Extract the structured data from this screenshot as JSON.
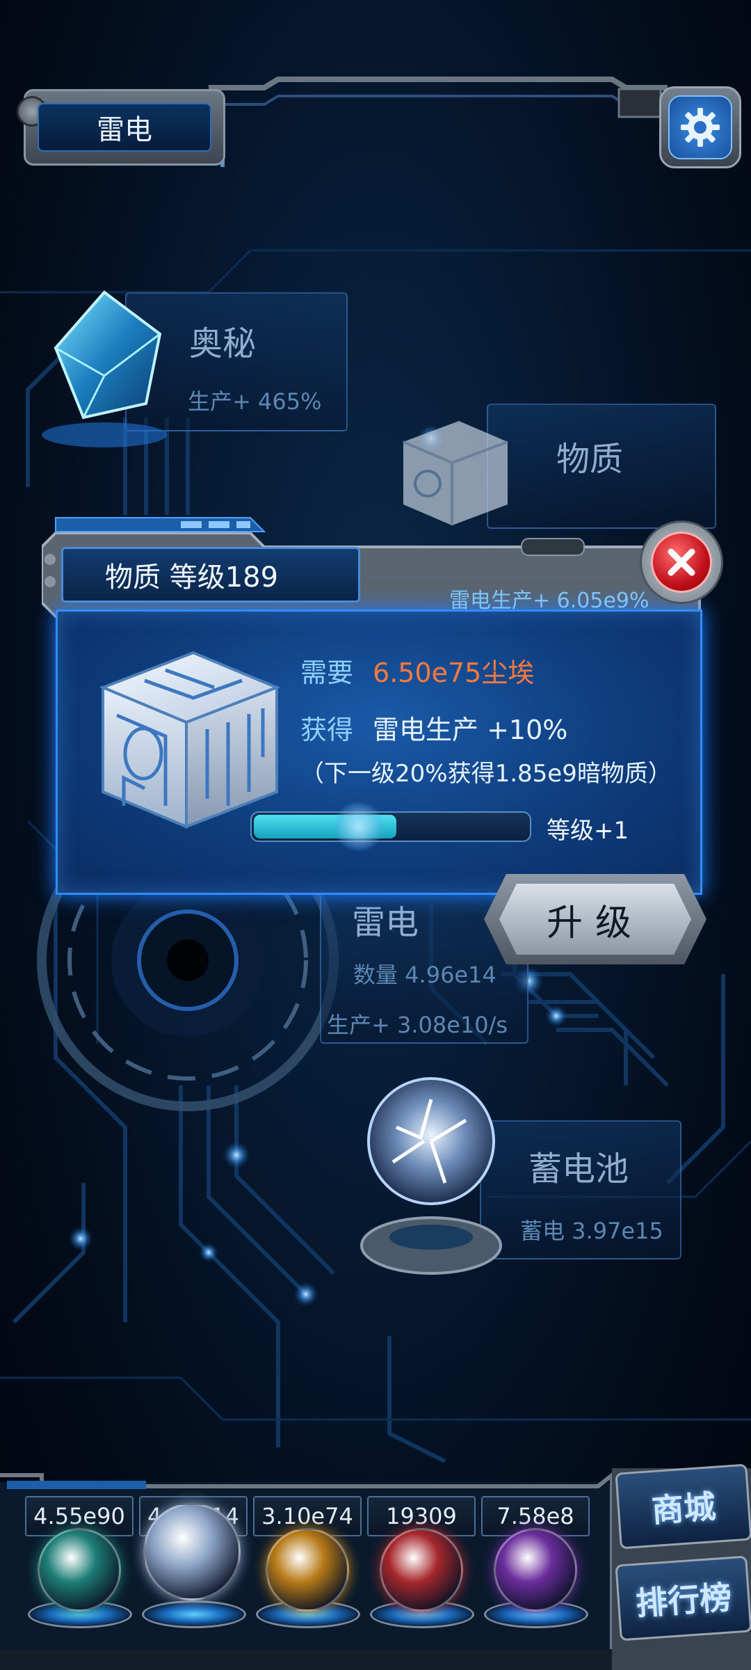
{
  "header": {
    "title": "雷电"
  },
  "nodes": {
    "mystery": {
      "name": "奥秘",
      "stat": "生产+ 465%"
    },
    "matter": {
      "name": "物质",
      "stat": "生产+ 6.05e9%"
    },
    "thunder": {
      "name": "雷电",
      "count": "数量 4.96e14",
      "stat": "生产+ 3.08e10/s"
    },
    "battery": {
      "name": "蓄电池",
      "stat": "蓄电 3.97e15"
    }
  },
  "dialog": {
    "title": "物质 等级189",
    "subtitle": "雷电生产+ 6.05e9%",
    "require_label": "需要",
    "require_value": "6.50e75尘埃",
    "gain_label": "获得",
    "gain_value": "雷电生产 +10%",
    "next_level_note": "（下一级20%获得1.85e9暗物质）",
    "progress_fraction": 0.52,
    "level_increment": "等级+1",
    "upgrade_label": "升级"
  },
  "resources": [
    {
      "value": "4.55e90",
      "color": "#1d7d76"
    },
    {
      "value": "4.10e14",
      "color": "#8ea6c8"
    },
    {
      "value": "3.10e74",
      "color": "#b77a17"
    },
    {
      "value": "19309",
      "color": "#a6272c"
    },
    {
      "value": "7.58e8",
      "color": "#6a2d9c"
    }
  ],
  "side_buttons": {
    "shop": "商城",
    "ranking": "排行榜"
  }
}
